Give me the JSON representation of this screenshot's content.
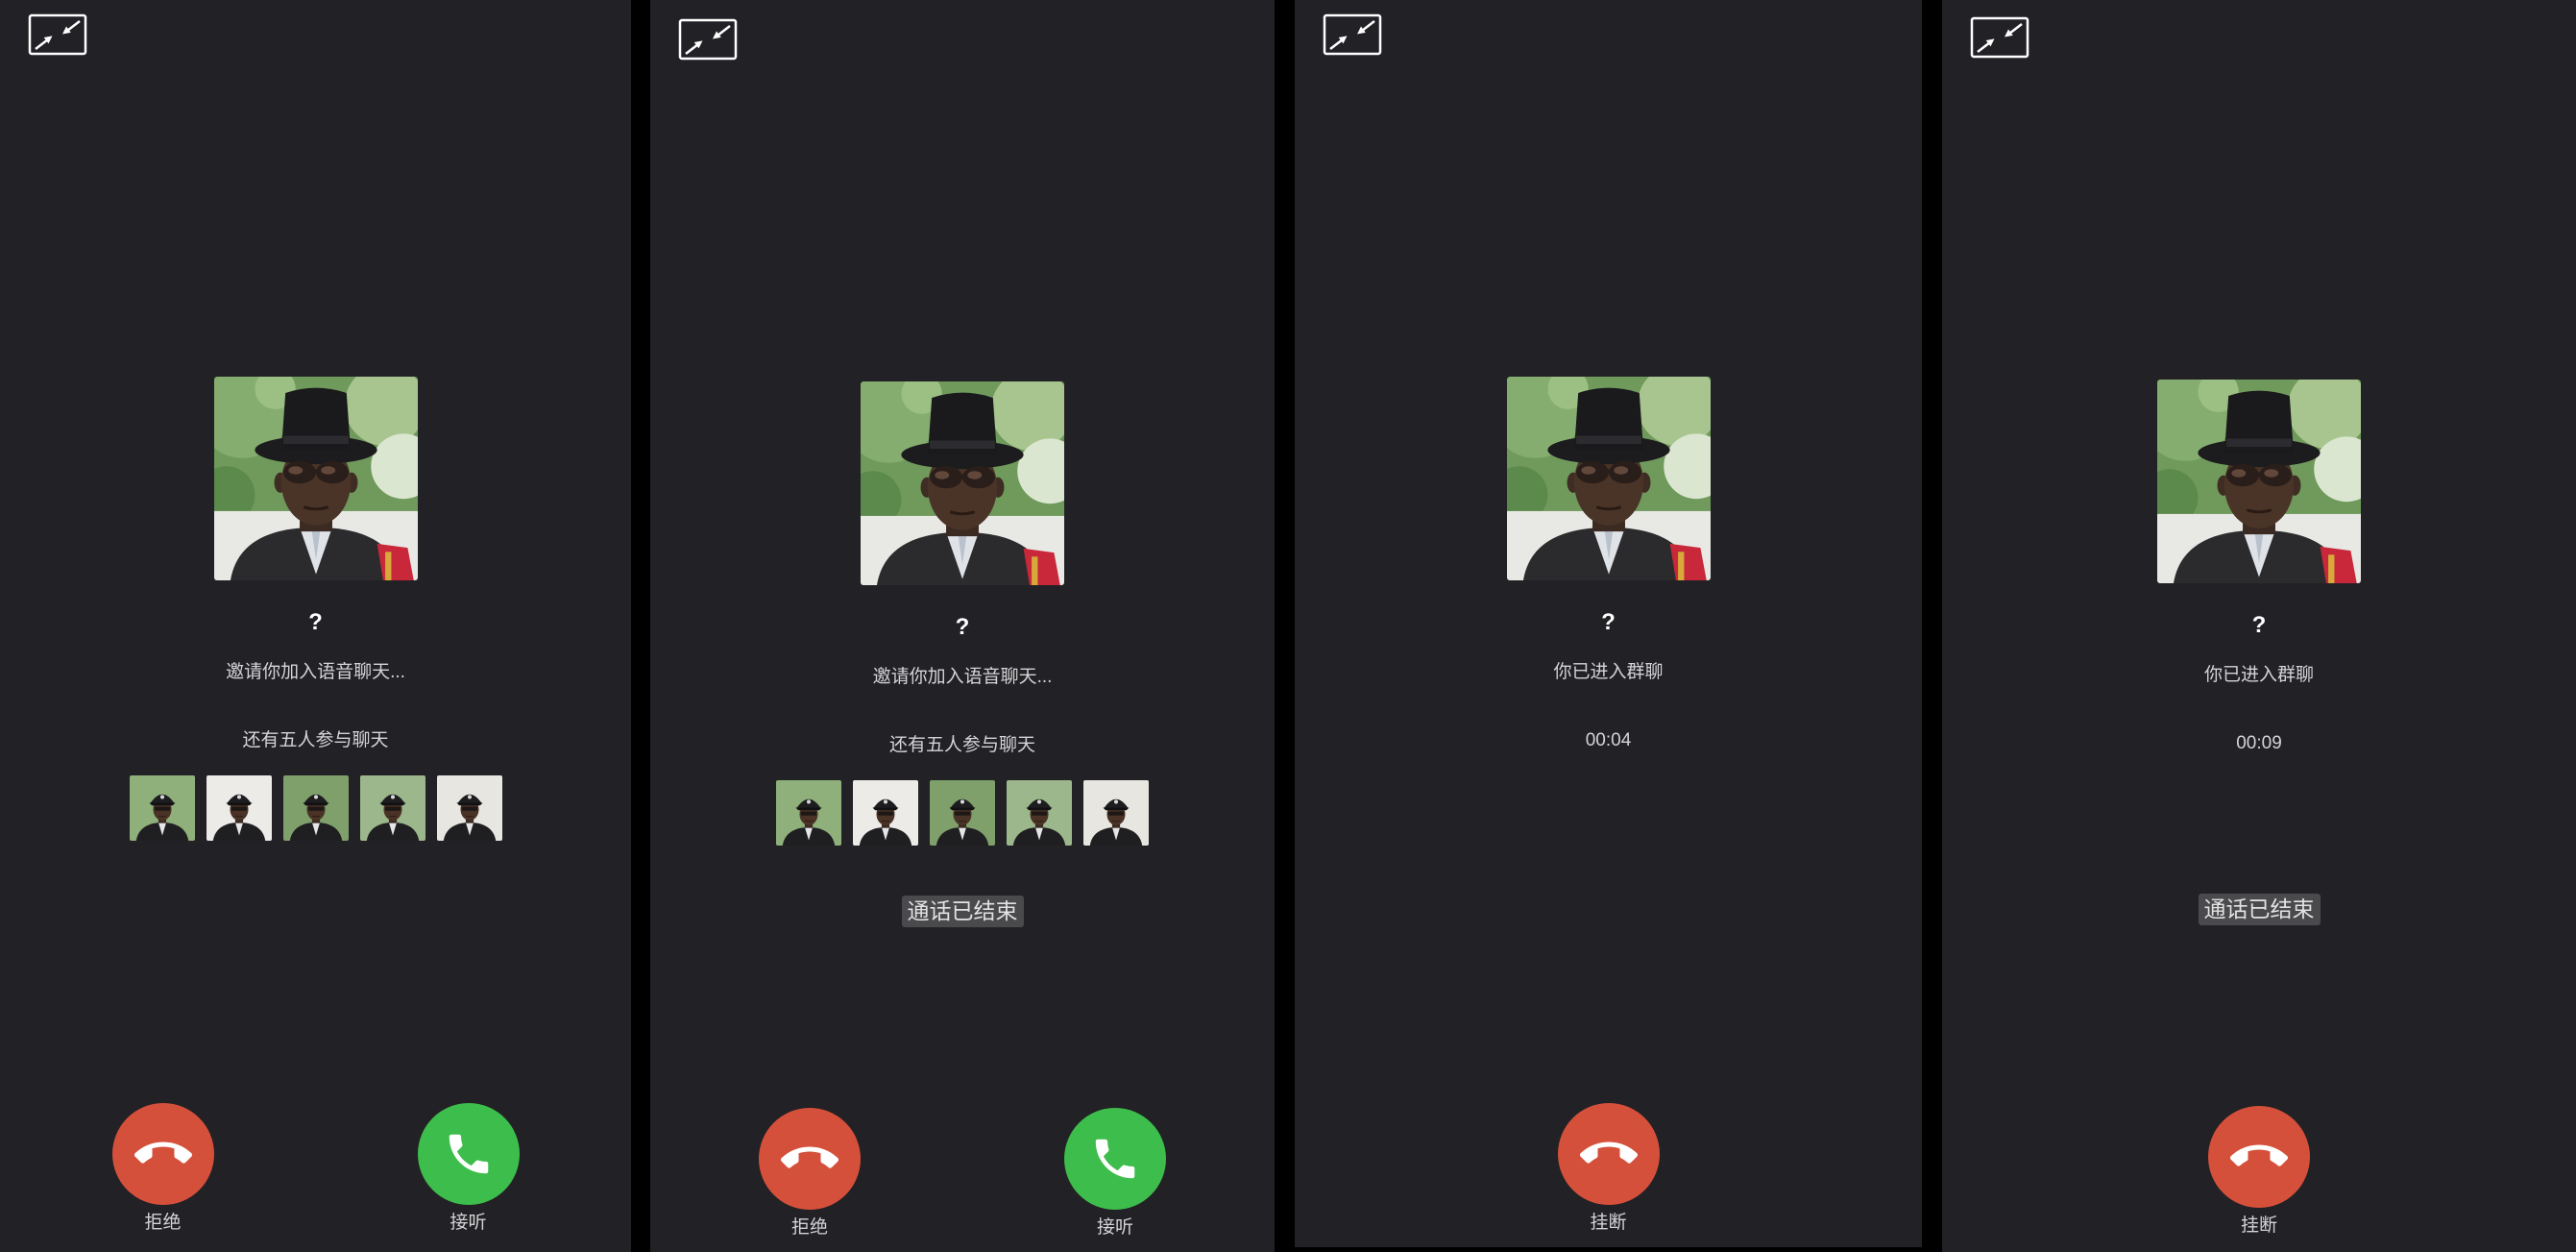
{
  "screens": [
    {
      "caller_name": "?",
      "status": "邀请你加入语音聊天...",
      "participants_text": "还有五人参与聊天",
      "actions": [
        {
          "label": "拒绝",
          "icon": "phone-hangup-icon"
        },
        {
          "label": "接听",
          "icon": "phone-icon"
        }
      ]
    },
    {
      "caller_name": "?",
      "status": "邀请你加入语音聊天...",
      "participants_text": "还有五人参与聊天",
      "toast": "通话已结束",
      "actions": [
        {
          "label": "拒绝",
          "icon": "phone-hangup-icon"
        },
        {
          "label": "接听",
          "icon": "phone-icon"
        }
      ]
    },
    {
      "caller_name": "?",
      "status": "你已进入群聊",
      "timer": "00:04",
      "actions": [
        {
          "label": "挂断",
          "icon": "phone-hangup-icon"
        }
      ]
    },
    {
      "caller_name": "?",
      "status": "你已进入群聊",
      "timer": "00:09",
      "toast": "通话已结束",
      "actions": [
        {
          "label": "挂断",
          "icon": "phone-hangup-icon"
        }
      ]
    }
  ],
  "icons": {
    "minimize": "minimize-window-icon",
    "decline": "phone-hangup-icon",
    "accept": "phone-icon"
  },
  "colors": {
    "bg": "#222125",
    "decline": "#d5503b",
    "accept": "#3dbd4b",
    "toast-bg": "#4a494c"
  }
}
